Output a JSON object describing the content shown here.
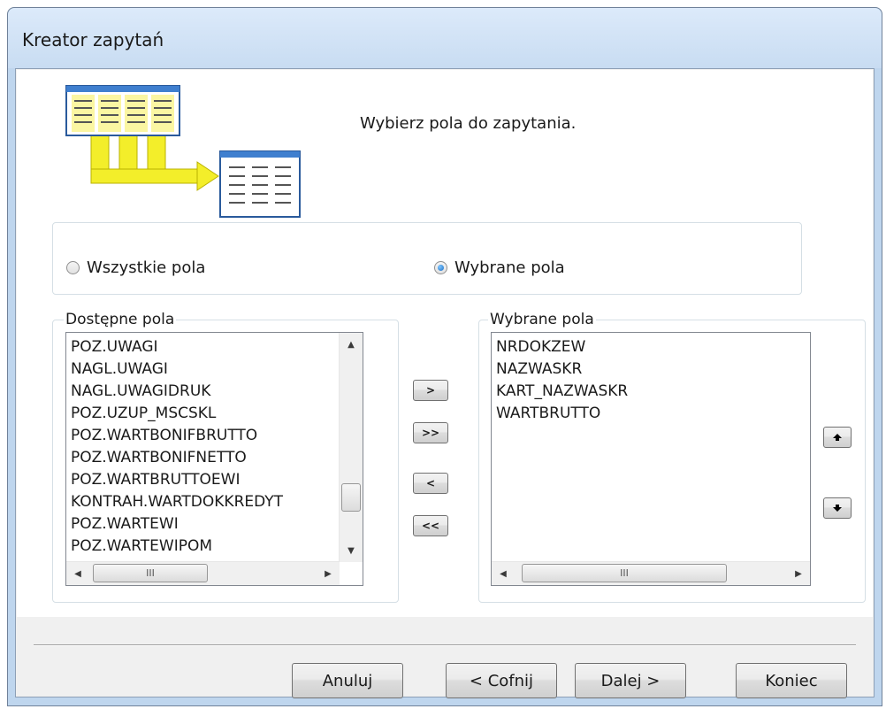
{
  "window": {
    "title": "Kreator zapytań"
  },
  "heading": "Wybierz pola do zapytania.",
  "radio_all": {
    "label": "Wszystkie pola",
    "checked": false
  },
  "radio_selected": {
    "label": "Wybrane pola",
    "checked": true
  },
  "available_fields": {
    "label": "Dostępne pola",
    "items": [
      "POZ.UWAGI",
      "NAGL.UWAGI",
      "NAGL.UWAGIDRUK",
      "POZ.UZUP_MSCSKL",
      "POZ.WARTBONIFBRUTTO",
      "POZ.WARTBONIFNETTO",
      "POZ.WARTBRUTTOEWI",
      "KONTRAH.WARTDOKKREDYT",
      "POZ.WARTEWI",
      "POZ.WARTEWIPOM"
    ]
  },
  "selected_fields": {
    "label": "Wybrane pola",
    "items": [
      "NRDOKZEW",
      "NAZWASKR",
      "KART_NAZWASKR",
      "WARTBRUTTO"
    ]
  },
  "transfer_buttons": {
    "add_one": ">",
    "add_all": ">>",
    "remove_one": "<",
    "remove_all": "<<"
  },
  "scrollbar": {
    "thumb_grip": "III"
  },
  "footer": {
    "cancel": "Anuluj",
    "back": "< Cofnij",
    "next": "Dalej >",
    "finish": "Koniec"
  }
}
